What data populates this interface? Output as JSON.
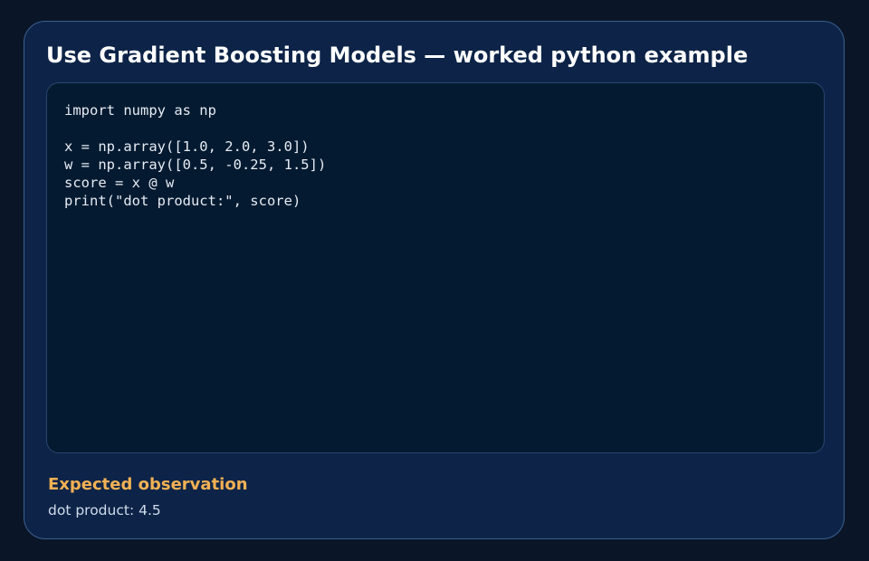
{
  "card": {
    "title": "Use Gradient Boosting Models — worked python example",
    "code": {
      "language": "python",
      "lines": [
        "import numpy as np",
        "",
        "x = np.array([1.0, 2.0, 3.0])",
        "w = np.array([0.5, -0.25, 1.5])",
        "score = x @ w",
        "print(\"dot product:\", score)"
      ]
    },
    "observation": {
      "heading": "Expected observation",
      "text": "dot product: 4.5"
    }
  },
  "colors": {
    "background": "#0a1628",
    "card": "#0d2448",
    "code_panel": "#041a30",
    "title": "#ffffff",
    "accent": "#f2b154"
  }
}
